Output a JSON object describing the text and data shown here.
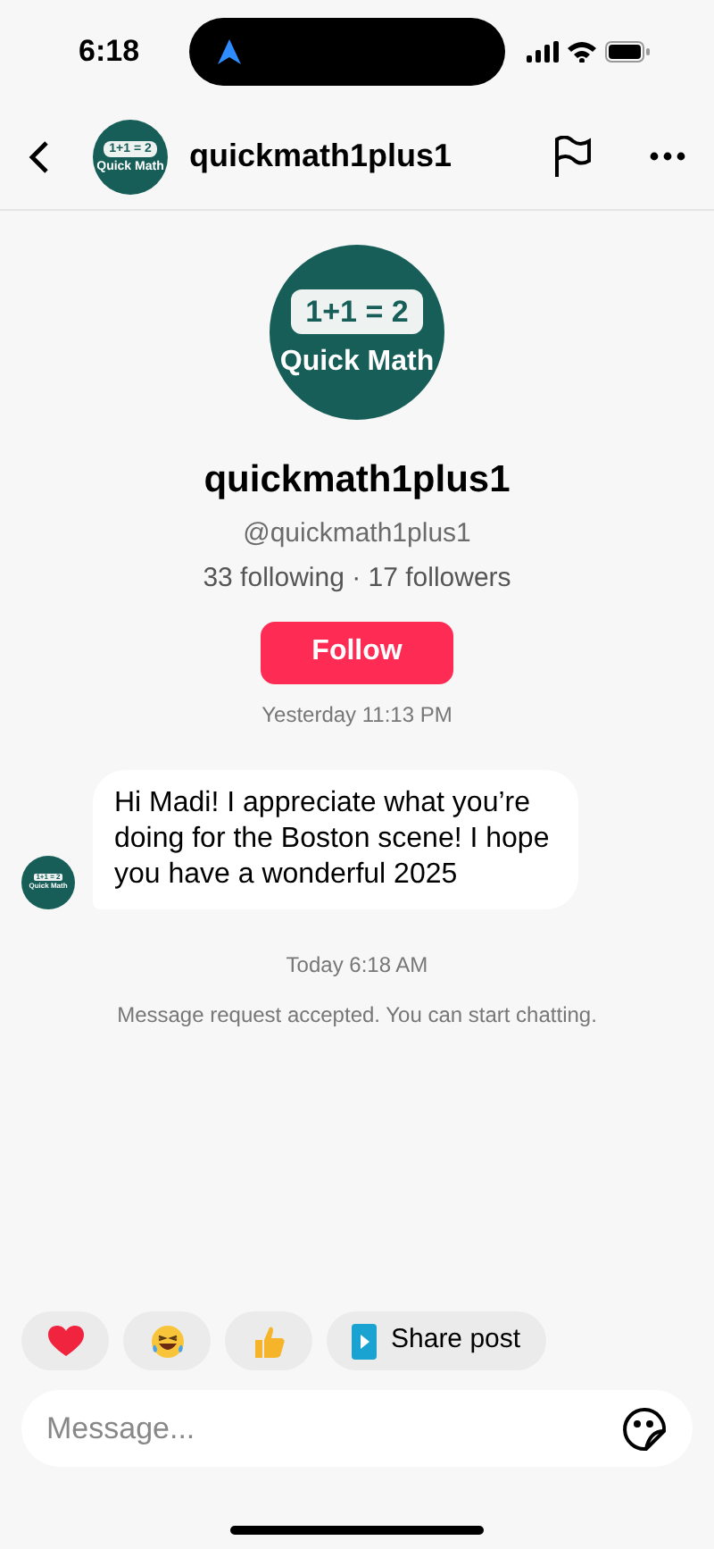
{
  "status_bar": {
    "time": "6:18"
  },
  "header": {
    "logo": {
      "top": "1+1 = 2",
      "bottom": "Quick Math"
    },
    "title": "quickmath1plus1"
  },
  "profile": {
    "logo": {
      "top": "1+1 = 2",
      "bottom": "Quick Math"
    },
    "name": "quickmath1plus1",
    "handle": "@quickmath1plus1",
    "stats": "33 following · 17 followers",
    "follow_button": "Follow"
  },
  "messages": [
    {
      "kind": "timestamp",
      "text": "Yesterday 11:13 PM"
    },
    {
      "kind": "incoming",
      "text": "Hi Madi! I appreciate what you’re doing for the Boston scene! I hope you have a wonderful 2025",
      "logo": {
        "top": "1+1 = 2",
        "bottom": "Quick Math"
      }
    },
    {
      "kind": "timestamp",
      "text": "Today 6:18 AM"
    },
    {
      "kind": "system",
      "text": "Message request accepted. You can start chatting."
    }
  ],
  "quick_replies": [
    {
      "kind": "heart"
    },
    {
      "kind": "laugh"
    },
    {
      "kind": "thumbs"
    },
    {
      "kind": "share",
      "label": "Share post"
    }
  ],
  "composer": {
    "placeholder": "Message..."
  }
}
